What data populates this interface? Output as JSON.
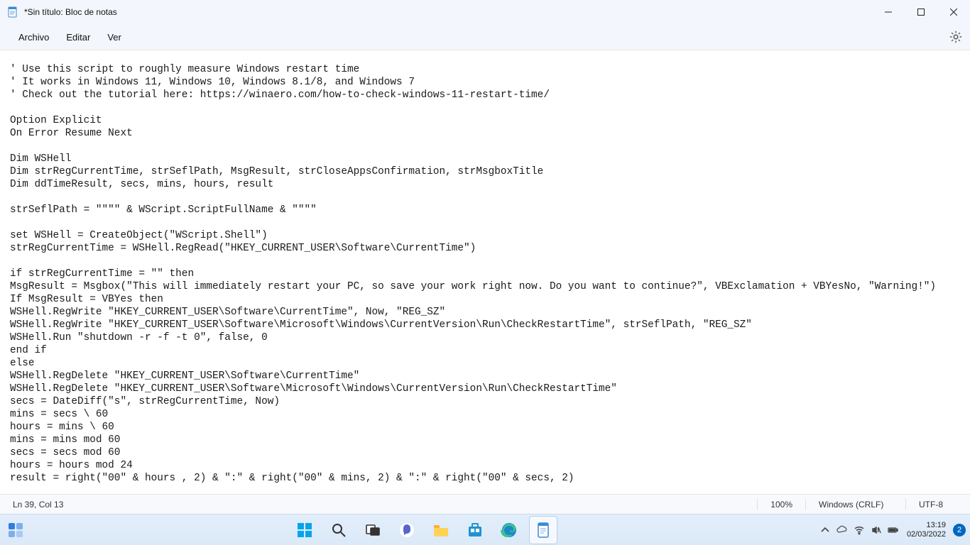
{
  "window": {
    "title": "*Sin título: Bloc de notas"
  },
  "menu": {
    "file": "Archivo",
    "edit": "Editar",
    "view": "Ver"
  },
  "editor": {
    "content": "' Use this script to roughly measure Windows restart time\n' It works in Windows 11, Windows 10, Windows 8.1/8, and Windows 7\n' Check out the tutorial here: https://winaero.com/how-to-check-windows-11-restart-time/\n\nOption Explicit\nOn Error Resume Next\n\nDim WSHell\nDim strRegCurrentTime, strSeflPath, MsgResult, strCloseAppsConfirmation, strMsgboxTitle\nDim ddTimeResult, secs, mins, hours, result\n\nstrSeflPath = \"\"\"\" & WScript.ScriptFullName & \"\"\"\"\n\nset WSHell = CreateObject(\"WScript.Shell\")\nstrRegCurrentTime = WSHell.RegRead(\"HKEY_CURRENT_USER\\Software\\CurrentTime\")\n\nif strRegCurrentTime = \"\" then\nMsgResult = Msgbox(\"This will immediately restart your PC, so save your work right now. Do you want to continue?\", VBExclamation + VBYesNo, \"Warning!\")\nIf MsgResult = VBYes then\nWSHell.RegWrite \"HKEY_CURRENT_USER\\Software\\CurrentTime\", Now, \"REG_SZ\"\nWSHell.RegWrite \"HKEY_CURRENT_USER\\Software\\Microsoft\\Windows\\CurrentVersion\\Run\\CheckRestartTime\", strSeflPath, \"REG_SZ\"\nWSHell.Run \"shutdown -r -f -t 0\", false, 0\nend if\nelse\nWSHell.RegDelete \"HKEY_CURRENT_USER\\Software\\CurrentTime\"\nWSHell.RegDelete \"HKEY_CURRENT_USER\\Software\\Microsoft\\Windows\\CurrentVersion\\Run\\CheckRestartTime\"\nsecs = DateDiff(\"s\", strRegCurrentTime, Now)\nmins = secs \\ 60\nhours = mins \\ 60\nmins = mins mod 60\nsecs = secs mod 60\nhours = hours mod 24\nresult = right(\"00\" & hours , 2) & \":\" & right(\"00\" & mins, 2) & \":\" & right(\"00\" & secs, 2)"
  },
  "status": {
    "cursor": "Ln 39, Col 13",
    "zoom": "100%",
    "line_ending": "Windows (CRLF)",
    "encoding": "UTF-8"
  },
  "taskbar": {
    "time": "13:19",
    "date": "02/03/2022",
    "notif_count": "2"
  }
}
